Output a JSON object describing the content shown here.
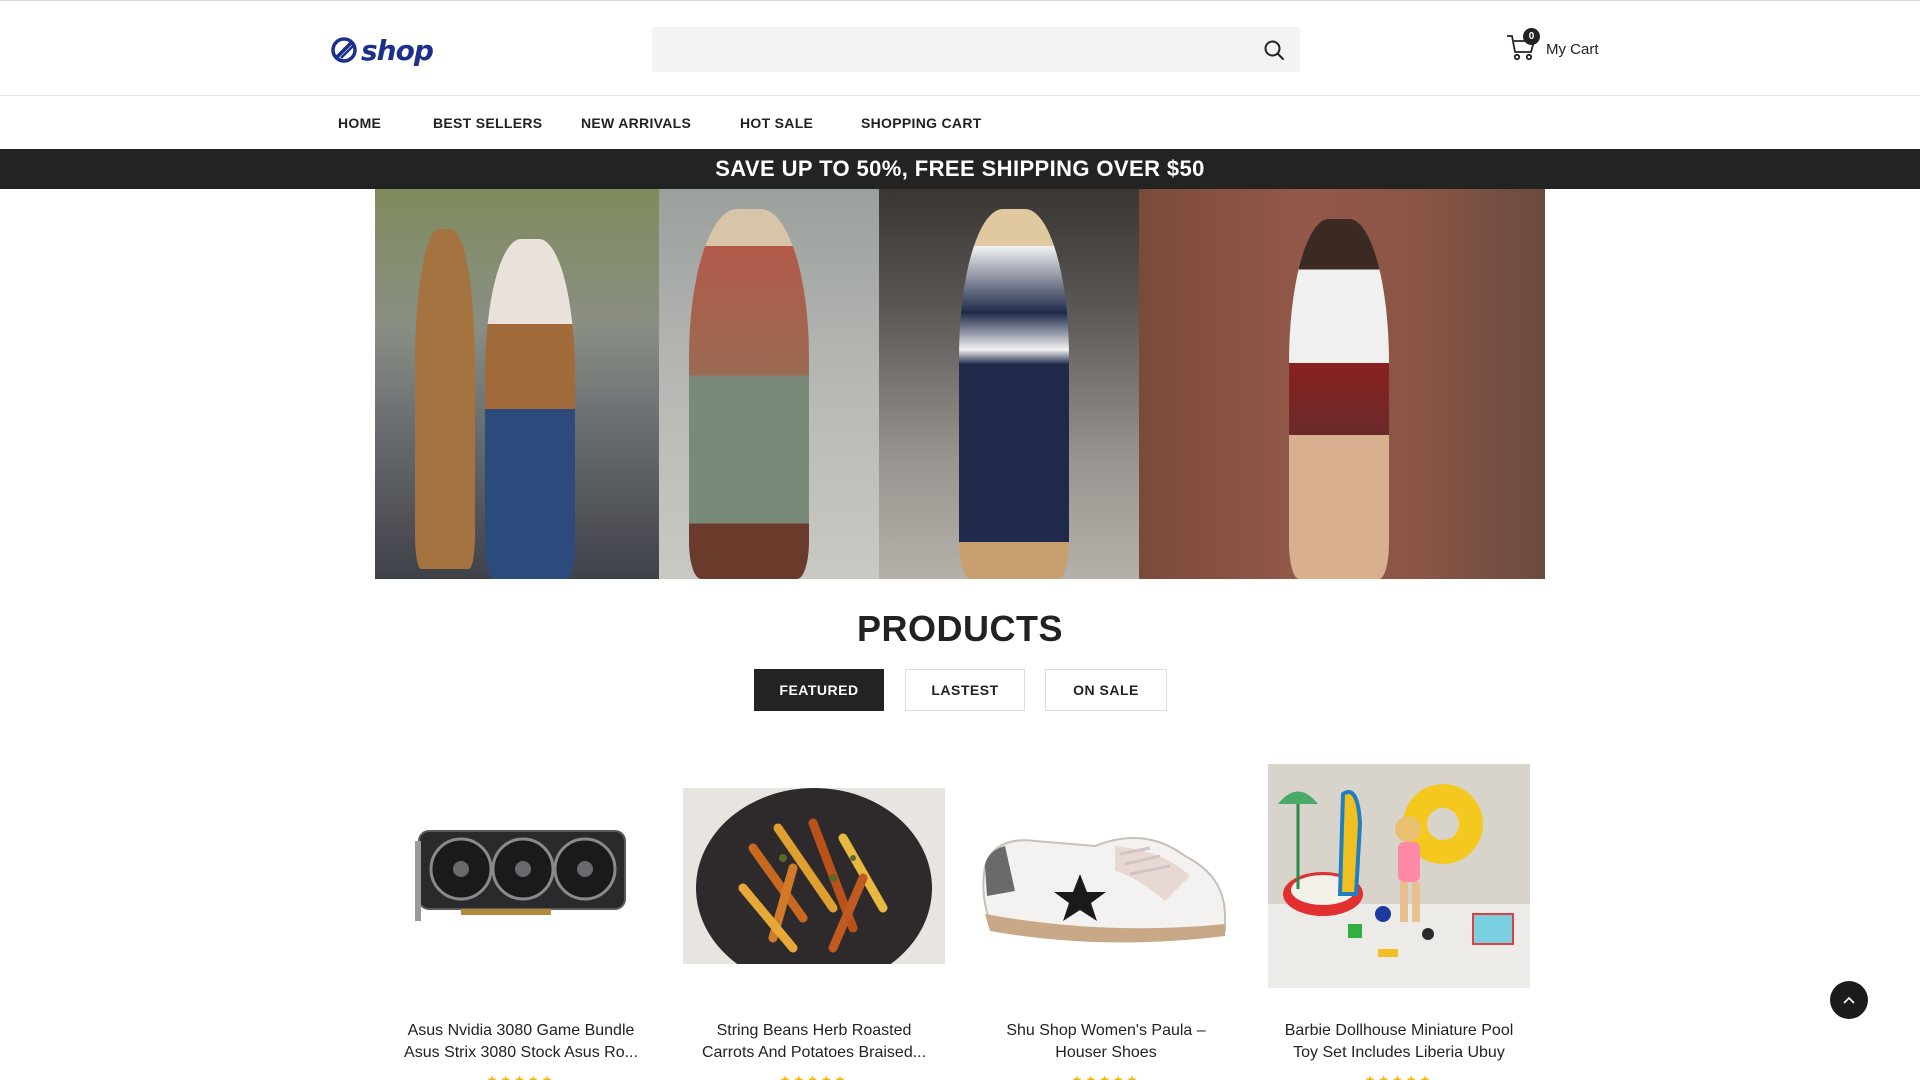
{
  "header": {
    "logo_text": "shop",
    "search": {
      "value": "",
      "placeholder": ""
    },
    "cart": {
      "count": "0",
      "label": "My Cart"
    }
  },
  "nav": {
    "items": [
      "HOME",
      "BEST SELLERS",
      "NEW ARRIVALS",
      "HOT SALE",
      "SHOPPING CART"
    ]
  },
  "promo": {
    "text": "SAVE UP TO 50%, FREE SHIPPING OVER $50"
  },
  "products": {
    "title": "PRODUCTS",
    "tabs": [
      {
        "label": "FEATURED",
        "active": true
      },
      {
        "label": "LASTEST",
        "active": false
      },
      {
        "label": "ON SALE",
        "active": false
      }
    ],
    "items": [
      {
        "line1": "Asus Nvidia 3080 Game Bundle",
        "line2": "Asus Strix 3080 Stock Asus Ro...",
        "stars": "★★★★★"
      },
      {
        "line1": "String Beans Herb Roasted",
        "line2": "Carrots And Potatoes Braised...",
        "stars": "★★★★★"
      },
      {
        "line1": "Shu Shop Women's Paula –",
        "line2": "Houser Shoes",
        "stars": "★★★★★"
      },
      {
        "line1": "Barbie Dollhouse Miniature Pool",
        "line2": "Toy Set Includes Liberia Ubuy",
        "stars": "★★★★★"
      }
    ]
  },
  "colors": {
    "brand": "#1d2f8c",
    "dark": "#232323",
    "star": "#f5b301"
  }
}
